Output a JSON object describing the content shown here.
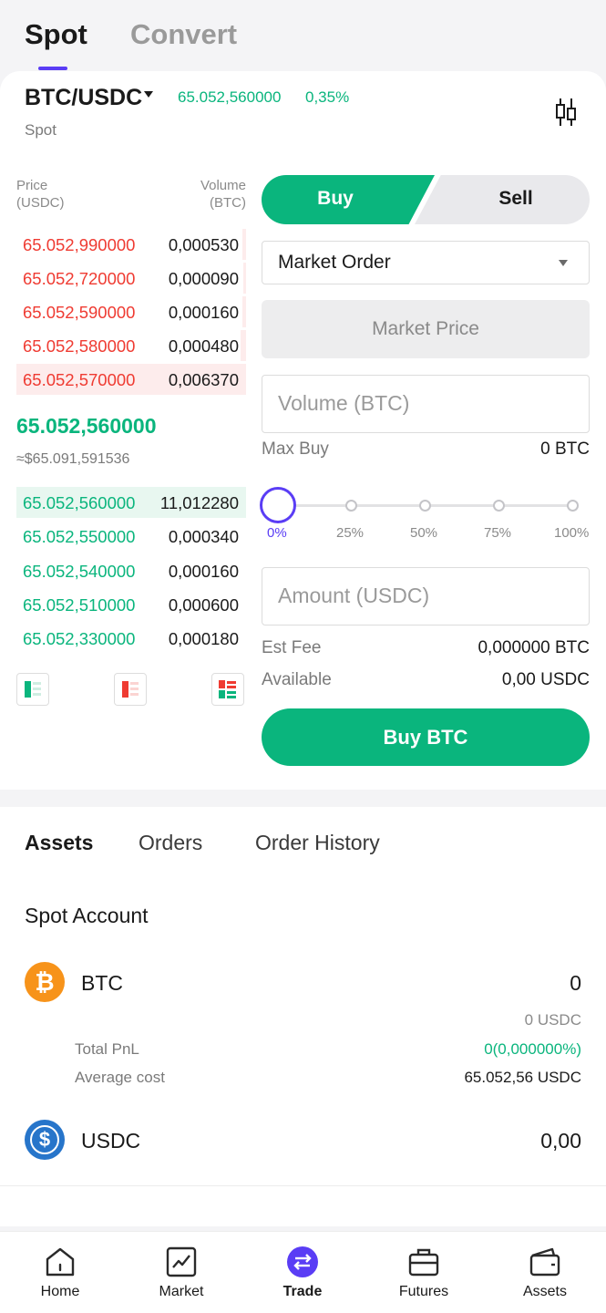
{
  "top_tabs": {
    "spot": "Spot",
    "convert": "Convert"
  },
  "pair": {
    "name": "BTC/USDC",
    "price": "65.052,560000",
    "change": "0,35%",
    "market": "Spot"
  },
  "orderbook": {
    "price_header_1": "Price",
    "price_header_2": "(USDC)",
    "volume_header_1": "Volume",
    "volume_header_2": "(BTC)",
    "asks": [
      {
        "price": "65.052,990000",
        "volume": "0,000530"
      },
      {
        "price": "65.052,720000",
        "volume": "0,000090"
      },
      {
        "price": "65.052,590000",
        "volume": "0,000160"
      },
      {
        "price": "65.052,580000",
        "volume": "0,000480"
      },
      {
        "price": "65.052,570000",
        "volume": "0,006370"
      }
    ],
    "last_price": "65.052,560000",
    "last_price_usd": "≈$65.091,591536",
    "bids": [
      {
        "price": "65.052,560000",
        "volume": "11,012280"
      },
      {
        "price": "65.052,550000",
        "volume": "0,000340"
      },
      {
        "price": "65.052,540000",
        "volume": "0,000160"
      },
      {
        "price": "65.052,510000",
        "volume": "0,000600"
      },
      {
        "price": "65.052,330000",
        "volume": "0,000180"
      }
    ]
  },
  "form": {
    "buy": "Buy",
    "sell": "Sell",
    "order_type": "Market Order",
    "market_price": "Market Price",
    "volume_placeholder": "Volume (BTC)",
    "max_buy_label": "Max Buy",
    "max_buy_value": "0 BTC",
    "slider_labels": [
      "0%",
      "25%",
      "50%",
      "75%",
      "100%"
    ],
    "slider_value": 0,
    "amount_placeholder": "Amount (USDC)",
    "est_fee_label": "Est Fee",
    "est_fee_value": "0,000000 BTC",
    "available_label": "Available",
    "available_value": "0,00 USDC",
    "submit": "Buy BTC"
  },
  "assets": {
    "tabs": [
      "Assets",
      "Orders",
      "Order History"
    ],
    "section_title": "Spot Account",
    "btc": {
      "symbol": "₿",
      "name": "BTC",
      "amount": "0",
      "usdc": "0 USDC",
      "pnl_label": "Total PnL",
      "pnl_value": "0(0,000000%)",
      "avg_label": "Average cost",
      "avg_value": "65.052,56 USDC"
    },
    "usdc": {
      "symbol": "$",
      "name": "USDC",
      "amount": "0,00"
    }
  },
  "nav": [
    "Home",
    "Market",
    "Trade",
    "Futures",
    "Assets"
  ],
  "colors": {
    "green": "#0ab57d",
    "red": "#ef3b32",
    "accent": "#5a3df5"
  }
}
